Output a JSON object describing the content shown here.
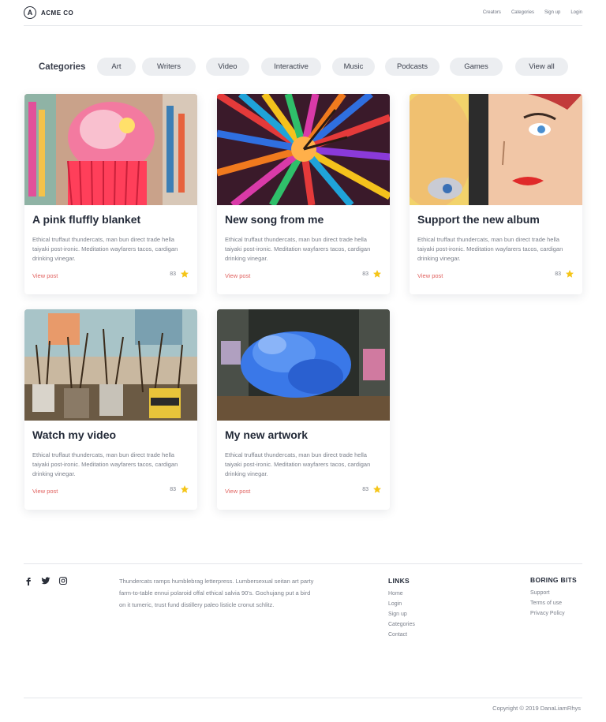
{
  "brand": {
    "mark": "A",
    "name": "ACME CO"
  },
  "nav": [
    "Creators",
    "Categories",
    "Sign up",
    "Login"
  ],
  "categories": {
    "label": "Categories",
    "items": [
      "Art",
      "Writers",
      "Video",
      "Interactive",
      "Music",
      "Podcasts",
      "Games",
      "View all"
    ]
  },
  "cards": [
    {
      "title": "A pink fluffly blanket",
      "desc": "Ethical truffaut thundercats, man bun direct trade hella taiyaki post-ironic. Meditation wayfarers tacos, cardigan drinking vinegar.",
      "link": "View post",
      "count": "83",
      "image": "pink-textile-photo"
    },
    {
      "title": "New song from me",
      "desc": "Ethical truffaut thundercats, man bun direct trade hella taiyaki post-ironic. Meditation wayfarers tacos, cardigan drinking vinegar.",
      "link": "View post",
      "count": "83",
      "image": "colorful-lanterns-photo"
    },
    {
      "title": "Support the new album",
      "desc": "Ethical truffaut thundercats, man bun direct trade hella taiyaki post-ironic. Meditation wayfarers tacos, cardigan drinking vinegar.",
      "link": "View post",
      "count": "83",
      "image": "pop-art-mural-photo"
    },
    {
      "title": "Watch my video",
      "desc": "Ethical truffaut thundercats, man bun direct trade hella taiyaki post-ironic. Meditation wayfarers tacos, cardigan drinking vinegar.",
      "link": "View post",
      "count": "83",
      "image": "paint-brushes-photo"
    },
    {
      "title": "My new artwork",
      "desc": "Ethical truffaut thundercats, man bun direct trade hella taiyaki post-ironic. Meditation wayfarers tacos, cardigan drinking vinegar.",
      "link": "View post",
      "count": "83",
      "image": "blue-smoke-tunnel-photo"
    }
  ],
  "footer": {
    "social": [
      "facebook-icon",
      "twitter-icon",
      "instagram-icon"
    ],
    "about": "Thundercats ramps humblebrag letterpress. Lumbersexual seitan art party farm-to-table ennui polaroid offal ethical salvia 90's. Gochujang put a bird on it tumeric, trust fund distillery paleo listicle cronut schlitz.",
    "links": {
      "title": "LINKS",
      "items": [
        "Home",
        "Login",
        "Sign up",
        "Categories",
        "Contact"
      ]
    },
    "boring": {
      "title": "BORING BITS",
      "items": [
        "Support",
        "Terms of use",
        "Privacy Policy"
      ]
    },
    "copyright": "Copyright © 2019 DanaLiamRhys"
  },
  "colors": {
    "accent": "#e0605e",
    "star": "#f5c518",
    "pill": "#eceef1"
  }
}
